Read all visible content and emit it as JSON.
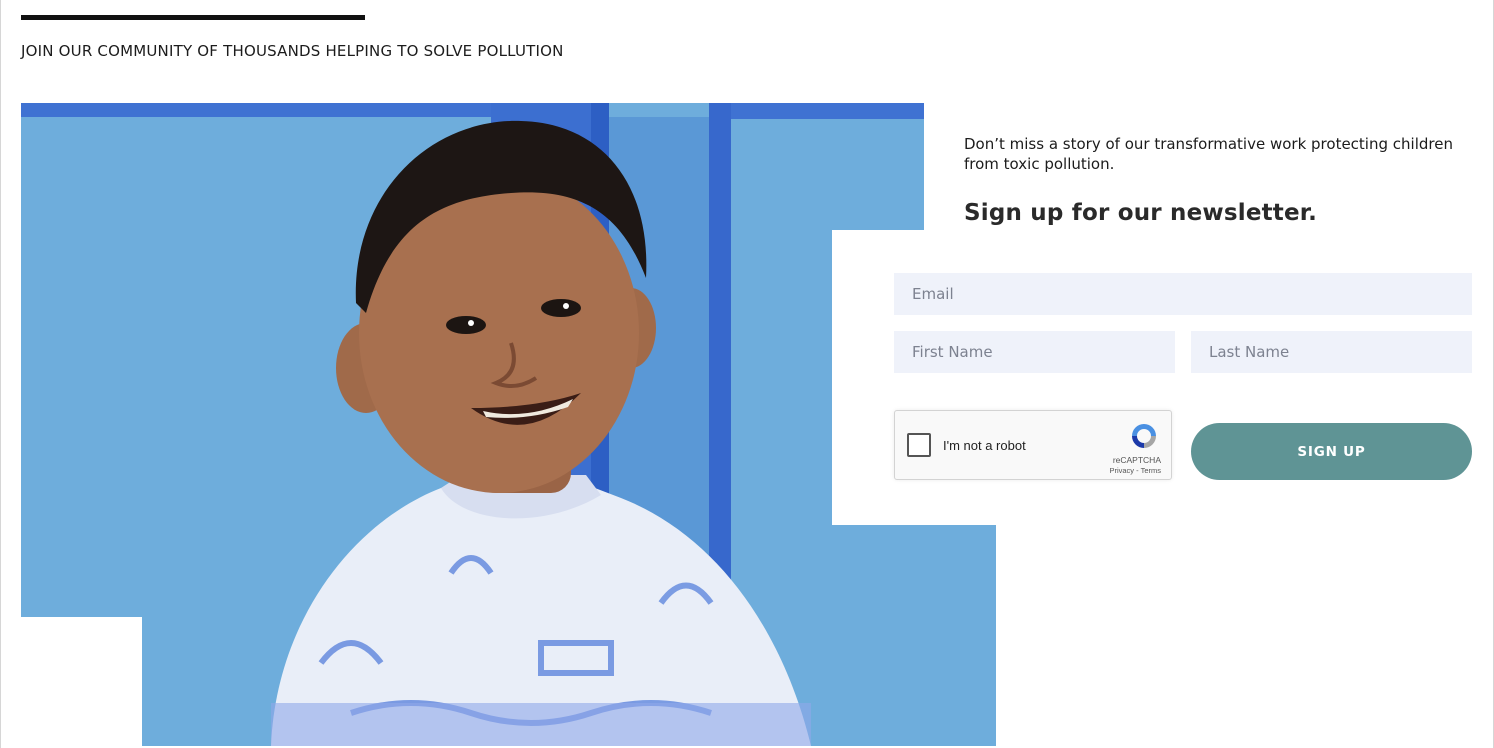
{
  "header": {
    "kicker": "JOIN OUR COMMUNITY OF THOUSANDS HELPING TO SOLVE POLLUTION"
  },
  "newsletter": {
    "intro": "Don’t miss a story of our transformative work protecting children from toxic pollution.",
    "headline": "Sign up for our newsletter.",
    "email_placeholder": "Email",
    "first_name_placeholder": "First Name",
    "last_name_placeholder": "Last Name",
    "submit_label": "SIGN UP"
  },
  "recaptcha": {
    "label": "I'm not a robot",
    "brand": "reCAPTCHA",
    "privacy": "Privacy",
    "separator": " - ",
    "terms": "Terms"
  },
  "photo": {
    "subject": "smiling-child-photo"
  },
  "colors": {
    "accent_button": "#5f9495",
    "input_background": "#eff2fa",
    "photo_wall": "#6aa9da",
    "door_frame": "#3f6fd0"
  }
}
